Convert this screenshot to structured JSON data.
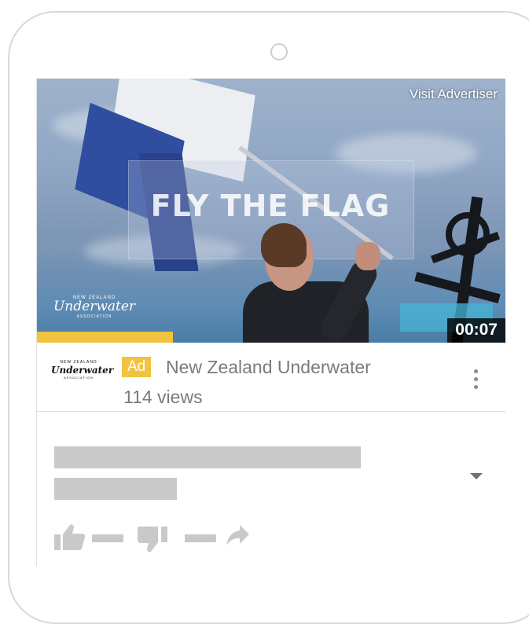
{
  "video": {
    "visit_label": "Visit Advertiser",
    "title_overlay": "FLY THE FLAG",
    "duration": "00:07",
    "progress_fraction": 0.29,
    "logo": {
      "top": "NEW ZEALAND",
      "script": "Underwater",
      "bottom": "ASSOCIATION"
    }
  },
  "ad": {
    "badge": "Ad",
    "channel": "New Zealand Underwater",
    "views": "114 views",
    "channel_logo": {
      "top": "NEW ZEALAND",
      "script": "Underwater",
      "bottom": "ASSOCIATION"
    }
  },
  "icons": {
    "menu": "more-vert-icon",
    "expand": "caret-down-icon",
    "like": "thumb-up-icon",
    "dislike": "thumb-down-icon",
    "share": "share-arrow-icon"
  },
  "colors": {
    "ad_yellow": "#f2c33f",
    "placeholder": "#c9c9c9",
    "text_gray": "#7a7a7a"
  }
}
